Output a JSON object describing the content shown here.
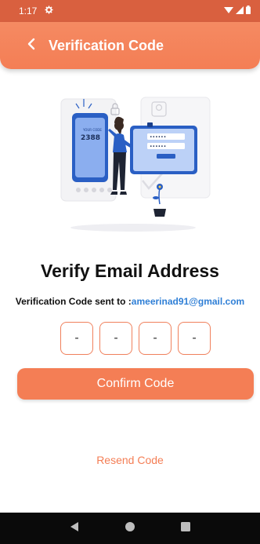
{
  "status_bar": {
    "time": "1:17"
  },
  "app_bar": {
    "title": "Verification Code"
  },
  "illustration": {
    "phone_code": "2388",
    "phone_label": "YOUR CODE"
  },
  "main": {
    "heading": "Verify Email Address",
    "sent_prefix": "Verification Code sent to :",
    "email": "ameerinad91@gmail.com",
    "code_digits": [
      "-",
      "-",
      "-",
      "-"
    ],
    "confirm_label": "Confirm Code",
    "resend_label": "Resend Code"
  },
  "colors": {
    "accent": "#f47e55",
    "status_bar": "#d9603f",
    "email_link": "#2f7fd6",
    "illustration_blue": "#2a5fc4"
  },
  "icons": {
    "status": [
      "gear-icon",
      "wifi-icon",
      "signal-icon",
      "battery-icon"
    ],
    "app_bar": "back-arrow-icon",
    "nav": [
      "nav-back-icon",
      "nav-home-icon",
      "nav-recents-icon"
    ]
  }
}
